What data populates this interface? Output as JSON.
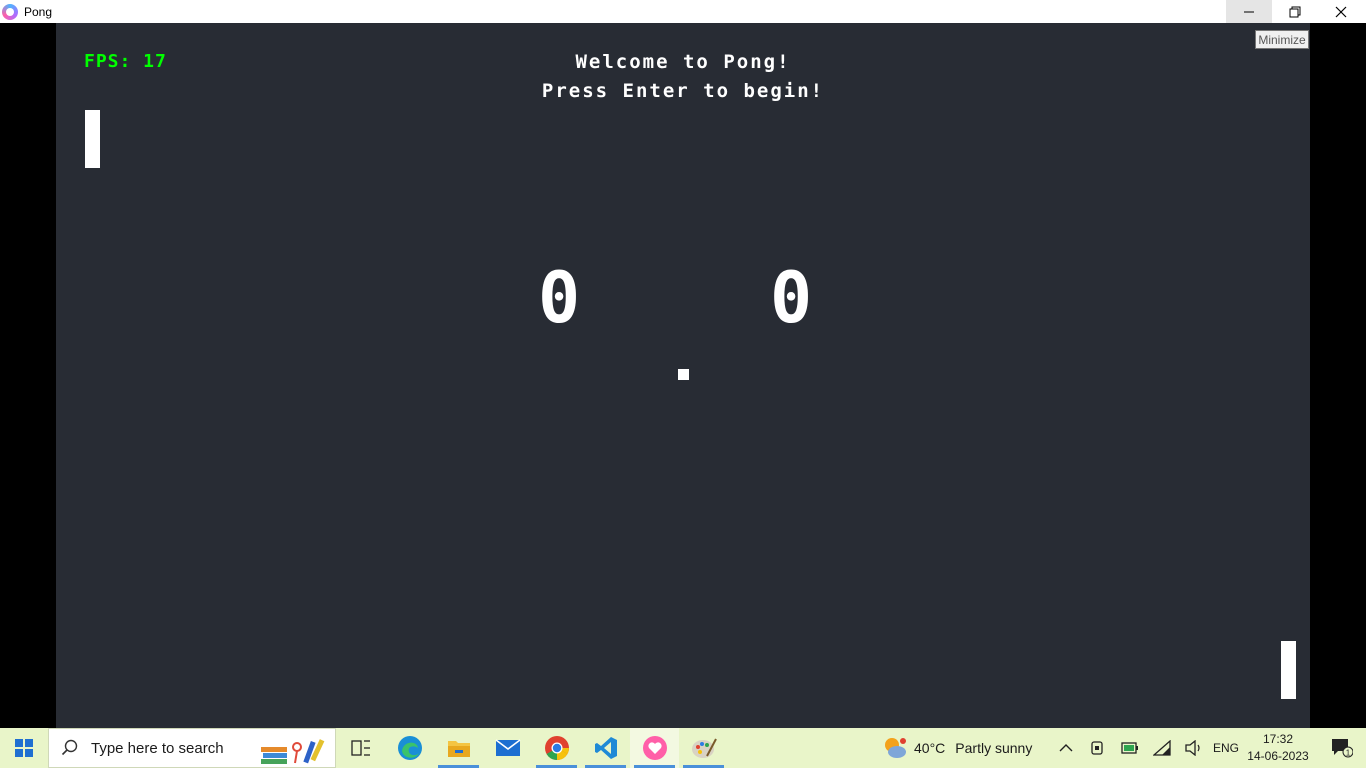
{
  "window": {
    "title": "Pong",
    "minimize_tooltip": "Minimize"
  },
  "game": {
    "fps_label": "FPS: 17",
    "welcome_line1": "Welcome to Pong!",
    "welcome_line2": "Press Enter to begin!",
    "score_left": "0",
    "score_right": "0"
  },
  "taskbar": {
    "search_placeholder": "Type here to search",
    "apps": [
      "task-view",
      "edge",
      "file-explorer",
      "mail",
      "chrome",
      "vscode",
      "pong",
      "paint"
    ],
    "weather": {
      "temp": "40°C",
      "condition": "Partly sunny"
    },
    "language": "ENG",
    "time": "17:32",
    "date": "14-06-2023",
    "notification_count": "1"
  },
  "colors": {
    "game_bg": "#282c34",
    "fps_green": "#00ff00",
    "taskbar_bg": "#e9f5c9"
  }
}
